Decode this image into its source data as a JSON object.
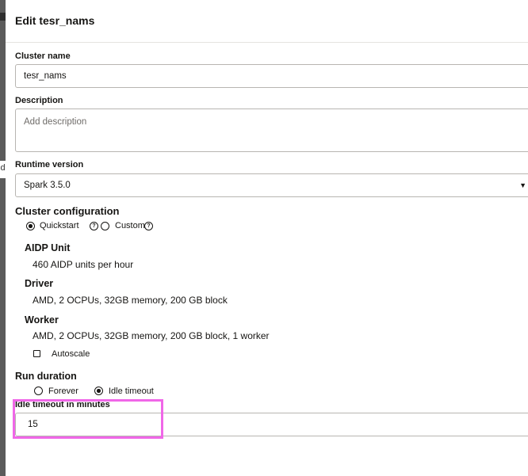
{
  "dialog": {
    "title": "Edit tesr_nams"
  },
  "cluster_name": {
    "label": "Cluster name",
    "value": "tesr_nams"
  },
  "description": {
    "label": "Description",
    "placeholder": "Add description"
  },
  "runtime": {
    "label": "Runtime version",
    "value": "Spark 3.5.0"
  },
  "cluster_config": {
    "heading": "Cluster configuration",
    "options": [
      {
        "label": "Quickstart",
        "selected": true
      },
      {
        "label": "Custom",
        "selected": false
      }
    ],
    "aidp_unit": {
      "label": "AIDP Unit",
      "value": "460 AIDP units per hour"
    },
    "driver": {
      "label": "Driver",
      "value": "AMD, 2 OCPUs, 32GB memory, 200 GB block"
    },
    "worker": {
      "label": "Worker",
      "value": "AMD, 2 OCPUs, 32GB memory, 200 GB block, 1 worker"
    },
    "autoscale": {
      "label": "Autoscale",
      "checked": false
    }
  },
  "run_duration": {
    "heading": "Run duration",
    "options": [
      {
        "label": "Forever",
        "selected": false
      },
      {
        "label": "Idle timeout",
        "selected": true
      }
    ]
  },
  "idle_timeout": {
    "label": "Idle timeout in minutes",
    "value": "15"
  },
  "colors": {
    "highlight": "#f067e8",
    "border": "#b8b5b1"
  }
}
